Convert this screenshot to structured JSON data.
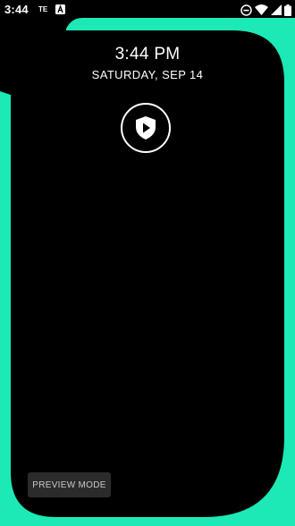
{
  "status_bar": {
    "time": "3:44",
    "carrier_label": "TE",
    "icons": [
      "a-notification-icon",
      "do-not-disturb-icon",
      "wifi-icon",
      "signal-icon",
      "battery-icon"
    ]
  },
  "lock_screen": {
    "time": "3:44 PM",
    "date": "SATURDAY, SEP 14",
    "center_icon": "shield-play-icon"
  },
  "preview_button": {
    "label": "PREVIEW MODE"
  },
  "colors": {
    "edge_light": "#1ce9b6",
    "background": "#000000",
    "text": "#ffffff",
    "button_bg": "#2b2b2b"
  }
}
